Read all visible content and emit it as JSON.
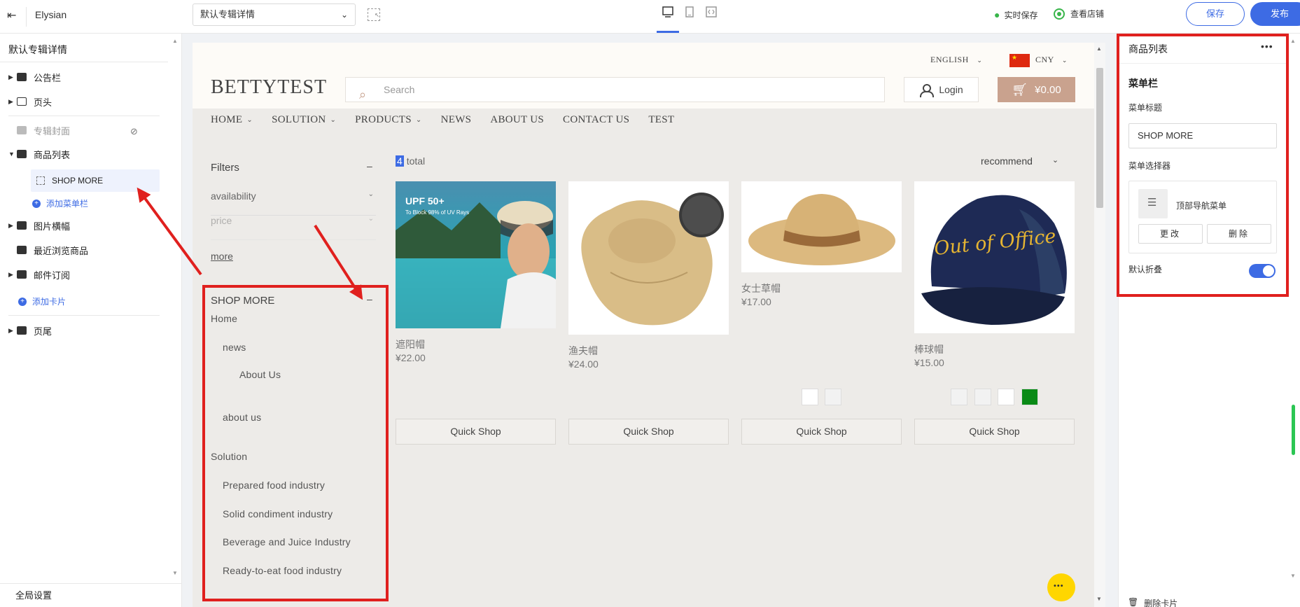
{
  "topbar": {
    "app_name": "Elysian",
    "template_select": "默认专辑详情",
    "autosave_label": "实时保存",
    "view_store_label": "查看店铺",
    "save_label": "保存",
    "publish_label": "发布"
  },
  "left_panel": {
    "heading": "默认专辑详情",
    "items": [
      {
        "label": "公告栏"
      },
      {
        "label": "页头"
      },
      {
        "label": "专辑封面"
      },
      {
        "label": "商品列表"
      },
      {
        "label": "SHOP MORE"
      },
      {
        "label": "添加菜单栏"
      },
      {
        "label": "图片横幅"
      },
      {
        "label": "最近浏览商品"
      },
      {
        "label": "邮件订阅"
      },
      {
        "label": "添加卡片"
      },
      {
        "label": "页尾"
      }
    ],
    "global_settings": "全局设置"
  },
  "store": {
    "language": "ENGLISH",
    "currency": "CNY",
    "brand": "BETTYTEST",
    "search_placeholder": "Search",
    "login_label": "Login",
    "cart_total": "¥0.00",
    "nav": [
      {
        "label": "HOME",
        "dropdown": true
      },
      {
        "label": "SOLUTION",
        "dropdown": true
      },
      {
        "label": "PRODUCTS",
        "dropdown": true
      },
      {
        "label": "NEWS",
        "dropdown": false
      },
      {
        "label": "ABOUT US",
        "dropdown": false
      },
      {
        "label": "CONTACT US",
        "dropdown": false
      },
      {
        "label": "TEST",
        "dropdown": false
      }
    ],
    "filters": {
      "title": "Filters",
      "collapse": "–",
      "rows": [
        "availability",
        "price"
      ],
      "more": "more"
    },
    "menu": {
      "title": "SHOP MORE",
      "collapse": "–",
      "items": [
        "Home",
        "news",
        "About Us",
        "about us",
        "Solution",
        "Prepared food industry",
        "Solid condiment industry",
        "Beverage and Juice Industry",
        "Ready-to-eat food industry"
      ]
    },
    "listing": {
      "total_count": "4",
      "total_label": "total",
      "sort_label": "recommend",
      "quick_shop": "Quick Shop",
      "products": [
        {
          "name": "遮阳帽",
          "price": "¥22.00",
          "image_text": "UPF 50+",
          "image_sub": "To Block 98% of UV Rays",
          "swatches": []
        },
        {
          "name": "渔夫帽",
          "price": "¥24.00",
          "swatches": []
        },
        {
          "name": "女士草帽",
          "price": "¥17.00",
          "swatches": [
            "#ffffff",
            "#f2f2f2"
          ]
        },
        {
          "name": "棒球帽",
          "price": "¥15.00",
          "image_text": "Out of Office",
          "swatches": [
            "#f2f2f2",
            "#f2f2f2",
            "#ffffff",
            "#0a8a16"
          ]
        }
      ]
    }
  },
  "right_panel": {
    "title": "商品列表",
    "more": "•••",
    "section_title": "菜单栏",
    "menu_title_label": "菜单标题",
    "menu_title_value": "SHOP MORE",
    "menu_selector_label": "菜单选择器",
    "selected_menu": "顶部导航菜单",
    "change_label": "更改",
    "delete_label": "删除",
    "default_collapse_label": "默认折叠",
    "default_collapse_on": true,
    "delete_card_label": "删除卡片"
  },
  "colors": {
    "accent": "#3d6be4",
    "annotation_red": "#e0201e",
    "cart_button": "#c9a28e",
    "chat_button": "#ffd600",
    "status_green": "#38b54a"
  }
}
